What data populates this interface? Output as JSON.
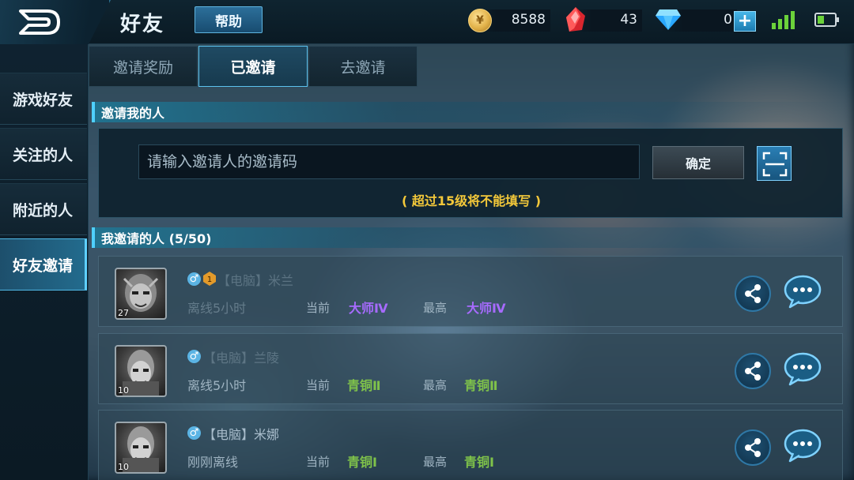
{
  "header": {
    "title": "好友",
    "help_label": "帮助"
  },
  "resources": {
    "coins": "8588",
    "coin_symbol": "¥",
    "gems": "43",
    "diamonds": "0",
    "add_symbol": "+"
  },
  "sidebar": {
    "items": [
      {
        "label": "游戏好友"
      },
      {
        "label": "关注的人"
      },
      {
        "label": "附近的人"
      },
      {
        "label": "好友邀请"
      }
    ],
    "active_index": 3
  },
  "tabs": [
    {
      "label": "邀请奖励"
    },
    {
      "label": "已邀请"
    },
    {
      "label": "去邀请"
    }
  ],
  "active_tab": 1,
  "invited_me": {
    "header": "邀请我的人",
    "input_placeholder": "请输入邀请人的邀请码",
    "confirm_label": "确定",
    "hint": "( 超过15级将不能填写 )"
  },
  "my_invites": {
    "header": "我邀请的人 (5/50)",
    "current_label": "当前",
    "highest_label": "最高",
    "rows": [
      {
        "level": "27",
        "name": "【电脑】米兰",
        "status": "离线5小时",
        "current_rank": "大师Ⅳ",
        "highest_rank": "大师Ⅳ"
      },
      {
        "level": "10",
        "name": "【电脑】兰陵",
        "status": "离线5小时",
        "current_rank": "青铜Ⅱ",
        "highest_rank": "青铜Ⅱ"
      },
      {
        "level": "10",
        "name": "【电脑】米娜",
        "status": "刚刚离线",
        "current_rank": "青铜Ⅰ",
        "highest_rank": "青铜Ⅰ"
      }
    ]
  },
  "colors": {
    "accent": "#4fd0ff",
    "master_rank": "#a76bff",
    "bronze_rank": "#7fc24a",
    "hint": "#f3c83a"
  }
}
